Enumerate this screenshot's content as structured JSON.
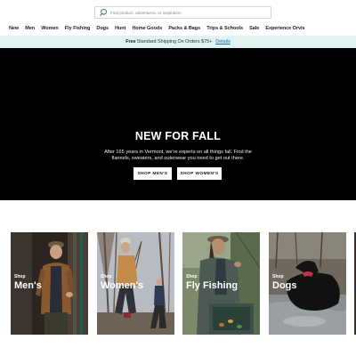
{
  "search": {
    "placeholder": "Find product, adventures, or inspiration",
    "icon": "search-icon"
  },
  "nav": {
    "items": [
      "New",
      "Men",
      "Women",
      "Fly Fishing",
      "Dogs",
      "Hunt",
      "Home Goods",
      "Packs & Bags",
      "Trips & Schools",
      "Sale",
      "Experience Orvis"
    ]
  },
  "promo": {
    "bold": "Free",
    "text": "Standard Shipping On Orders $75+",
    "link": "Details",
    "background": "#e1f2f2"
  },
  "hero": {
    "title": "NEW FOR FALL",
    "subtitle": "After 165 years in Vermont, we're experts on all things fall. Find the flannels, sweaters, and outerwear you need to get out there.",
    "buttons": {
      "men": "SHOP MEN'S",
      "women": "SHOP WOMEN'S"
    },
    "background": "#000000"
  },
  "categories": [
    {
      "shop": "Shop",
      "label": "Men's"
    },
    {
      "shop": "Shop",
      "label": "Women's"
    },
    {
      "shop": "Shop",
      "label": "Fly Fishing"
    },
    {
      "shop": "Shop",
      "label": "Dogs"
    }
  ]
}
